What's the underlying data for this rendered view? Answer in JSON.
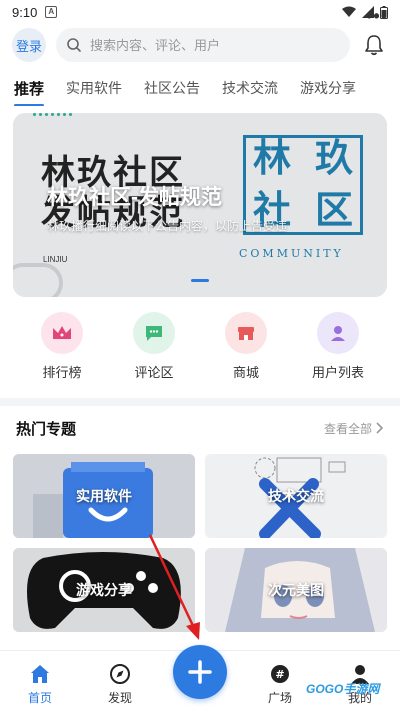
{
  "status_bar": {
    "time": "9:10",
    "note_icon": "A"
  },
  "header": {
    "login_label": "登录",
    "search_placeholder": "搜索内容、评论、用户"
  },
  "tabs": [
    {
      "label": "推荐",
      "active": true
    },
    {
      "label": "实用软件"
    },
    {
      "label": "社区公告"
    },
    {
      "label": "技术交流"
    },
    {
      "label": "游戏分享"
    }
  ],
  "banner": {
    "stamp_text_line1": "林玖社区",
    "stamp_text_line2": "发帖规范",
    "seal_chars": [
      "林",
      "玖",
      "社",
      "区"
    ],
    "seal_word": "COMMUNITY",
    "small_text": "LINJIU",
    "title": "林玖社区-发帖规范",
    "subtitle": "林玖播行细阅读以下公告内容，以防上告受违"
  },
  "quick_actions": [
    {
      "label": "排行榜",
      "icon": "crown-icon",
      "bg": "#fde4ec",
      "color": "#e0457b"
    },
    {
      "label": "评论区",
      "icon": "comment-icon",
      "bg": "#e0f4ea",
      "color": "#3cb878"
    },
    {
      "label": "商城",
      "icon": "store-icon",
      "bg": "#fde4e4",
      "color": "#e85a5a"
    },
    {
      "label": "用户列表",
      "icon": "user-icon",
      "bg": "#ece6fa",
      "color": "#9b6ee0"
    }
  ],
  "hot_topics": {
    "title": "热门专题",
    "more_label": "查看全部",
    "items": [
      {
        "label": "实用软件"
      },
      {
        "label": "技术交流"
      },
      {
        "label": "游戏分享"
      },
      {
        "label": "次元美图"
      }
    ]
  },
  "bottom_nav": [
    {
      "label": "首页",
      "icon": "home-icon",
      "active": true
    },
    {
      "label": "发现",
      "icon": "compass-icon"
    },
    {
      "label": "广场",
      "icon": "hashtag-icon"
    },
    {
      "label": "我的",
      "icon": "person-icon"
    }
  ],
  "watermark": "GOGO手游网",
  "colors": {
    "accent": "#2d7be0"
  }
}
